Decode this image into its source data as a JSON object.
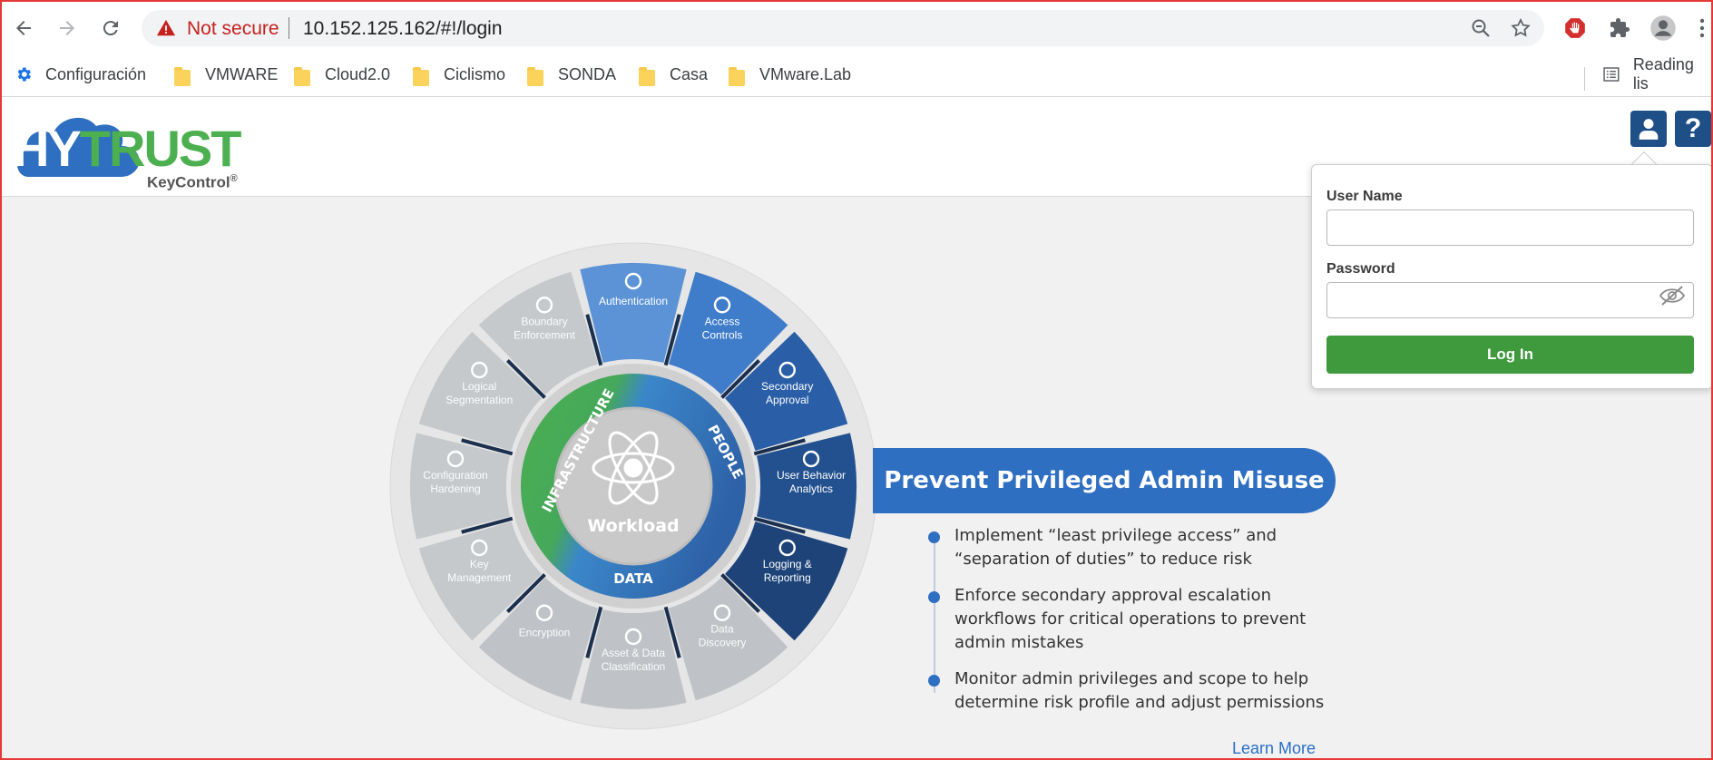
{
  "browser": {
    "security_label": "Not secure",
    "url": "10.152.125.162/#!/login",
    "bookmarks": [
      {
        "label": "Configuración",
        "icon": "gear-icon"
      },
      {
        "label": "VMWARE",
        "icon": "folder-icon"
      },
      {
        "label": "Cloud2.0",
        "icon": "folder-icon"
      },
      {
        "label": "Ciclismo",
        "icon": "folder-icon"
      },
      {
        "label": "SONDA",
        "icon": "folder-icon"
      },
      {
        "label": "Casa",
        "icon": "folder-icon"
      },
      {
        "label": "VMware.Lab",
        "icon": "folder-icon"
      }
    ],
    "reading_list": "Reading lis"
  },
  "app": {
    "logo_hy": "HY",
    "logo_trust": "TRUST",
    "logo_sub": "KeyControl",
    "logo_reg": "®",
    "help_label": "?"
  },
  "login": {
    "username_label": "User Name",
    "username_value": "",
    "password_label": "Password",
    "password_value": "",
    "submit_label": "Log In"
  },
  "wheel": {
    "center_label": "Workload",
    "ring_labels": {
      "infrastructure": "INFRASTRUCTURE",
      "people": "PEOPLE",
      "data": "DATA"
    },
    "segments": [
      {
        "label": [
          "Authentication"
        ],
        "color": "#5b93d6"
      },
      {
        "label": [
          "Access",
          "Controls"
        ],
        "color": "#3f7cca"
      },
      {
        "label": [
          "Secondary",
          "Approval"
        ],
        "color": "#2a5ea6"
      },
      {
        "label": [
          "User Behavior",
          "Analytics"
        ],
        "color": "#23518f"
      },
      {
        "label": [
          "Logging &",
          "Reporting"
        ],
        "color": "#1d4379"
      },
      {
        "label": [
          "Data",
          "Discovery"
        ],
        "color": "#bfc3c7"
      },
      {
        "label": [
          "Asset & Data",
          "Classification"
        ],
        "color": "#bfc3c7"
      },
      {
        "label": [
          "Encryption"
        ],
        "color": "#bfc3c7"
      },
      {
        "label": [
          "Key",
          "Management"
        ],
        "color": "#c5c9cc"
      },
      {
        "label": [
          "Configuration",
          "Hardening"
        ],
        "color": "#c5c9cc"
      },
      {
        "label": [
          "Logical",
          "Segmentation"
        ],
        "color": "#c5c9cc"
      },
      {
        "label": [
          "Boundary",
          "Enforcement"
        ],
        "color": "#c5c9cc"
      }
    ]
  },
  "feature": {
    "title": "Prevent Privileged Admin Misuse",
    "bullets": [
      [
        "Implement “least privilege access” and",
        "“separation of duties” to reduce risk"
      ],
      [
        "Enforce secondary approval escalation",
        "workflows for critical operations to prevent",
        "admin mistakes"
      ],
      [
        "Monitor admin privileges and scope to help",
        "determine risk profile and adjust permissions"
      ]
    ],
    "learn_more": "Learn More"
  },
  "colors": {
    "brand_blue": "#2f6fc1",
    "brand_green": "#4caf50",
    "login_green": "#3f9a3d",
    "header_button": "#1e4f87"
  }
}
